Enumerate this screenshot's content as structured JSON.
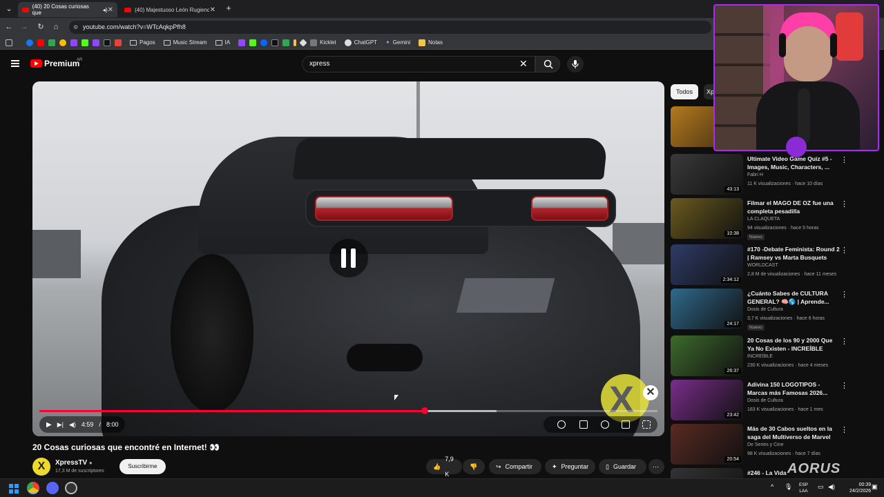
{
  "browser": {
    "tabs": [
      {
        "label": "(40) 20 Cosas curiosas que",
        "active": true
      },
      {
        "label": "(40) Majestuoso León Rugiendo",
        "active": false
      }
    ],
    "new_tab": "+",
    "url": "youtube.com/watch?v=WTcAqkpPfh8",
    "bookmarks": [
      "Pagos",
      "Music Stream",
      "IA",
      "Kicklet",
      "ChatGPT",
      "Gemini",
      "Notas"
    ]
  },
  "header": {
    "brand": "Premium",
    "region": "AR",
    "search_value": "xpress"
  },
  "player": {
    "current_time": "4:59",
    "separator": "/",
    "duration": "8:00",
    "progress": 0.624,
    "buffered": 0.74,
    "watermark_close": "✕"
  },
  "video": {
    "title": "20 Cosas curiosas que encontré en Internet! 👀",
    "channel": "XpressTV",
    "subscribers": "17,3 M de suscriptores",
    "subscribe_label": "Suscribirme",
    "likes": "7,9 K",
    "share_label": "Compartir",
    "ask_label": "Preguntar",
    "save_label": "Guardar"
  },
  "sidebar": {
    "chips": [
      "Todos",
      "Xp"
    ],
    "recommendations": [
      {
        "title": "Ultimate Video Game Quiz #5 - Images, Music, Characters, ...",
        "channel": "Fabri H",
        "meta": "11 K visualizaciones · hace 10 días",
        "duration": "43:13",
        "badge": "",
        "color": "#3a3a3a"
      },
      {
        "title": "Filmar el MAGO DE OZ fue una completa pesadilla",
        "channel": "LA CLAQUETA",
        "meta": "94 visualizaciones · hace 5 horas",
        "duration": "10:38",
        "badge": "Nuevo",
        "color": "#6b5a1e"
      },
      {
        "title": "#170 -Debate Feminista: Round 2 | Ramsey vs Marta Busquets",
        "channel": "WORLDCAST",
        "meta": "2,8 M de visualizaciones · hace 11 meses",
        "duration": "2:34:12",
        "badge": "",
        "color": "#2e3c66"
      },
      {
        "title": "¿Cuánto Sabes de CULTURA GENERAL? 🧠🌎 | Aprende...",
        "channel": "Dosis de Cultura",
        "meta": "3,7 K visualizaciones · hace 6 horas",
        "duration": "24:17",
        "badge": "Nuevo",
        "color": "#2f6a8c"
      },
      {
        "title": "20 Cosas de los 90 y 2000 Que Ya No Existen - INCREÍBLE",
        "channel": "INCREÍBLE",
        "meta": "230 K visualizaciones · hace 4 meses",
        "duration": "26:37",
        "badge": "",
        "color": "#3d6a2c"
      },
      {
        "title": "Adivina 150 LOGOTIPOS - Marcas más Famosas 2026...",
        "channel": "Dosis de Cultura",
        "meta": "183 K visualizaciones · hace 1 mes",
        "duration": "23:42",
        "badge": "",
        "color": "#7a2d8c"
      },
      {
        "title": "Más de 30 Cabos sueltos en la saga del Multiverso de Marvel",
        "channel": "De Series y Cine",
        "meta": "98 K visualizaciones · hace 7 días",
        "duration": "20:54",
        "badge": "",
        "color": "#5a2a22"
      },
      {
        "title": "#246 - La Vida",
        "channel": "",
        "meta": "",
        "duration": "",
        "badge": "",
        "color": "#333333"
      }
    ]
  },
  "overlay": {
    "brand": "AORUS"
  },
  "taskbar": {
    "language": "ESP",
    "layout": "LAA",
    "time": "00:39",
    "date": "24/2/2026"
  }
}
